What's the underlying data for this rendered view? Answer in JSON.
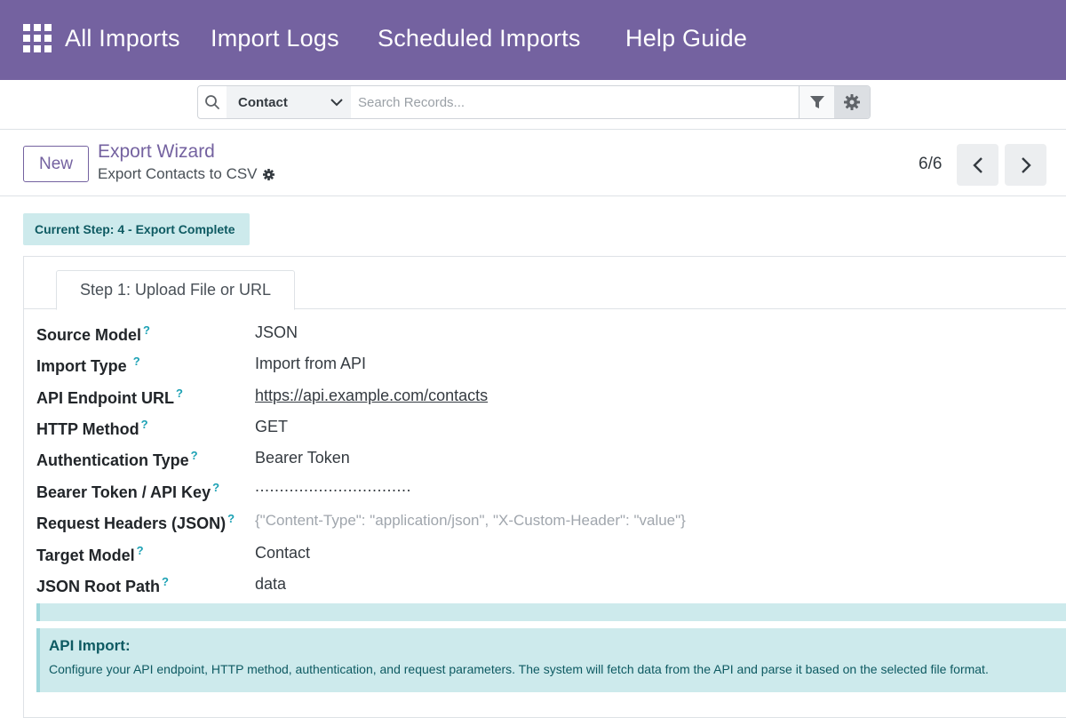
{
  "nav": {
    "items": [
      "All Imports",
      "Import Logs",
      "Scheduled Imports",
      "Help Guide"
    ]
  },
  "search": {
    "model": "Contact",
    "placeholder": "Search Records..."
  },
  "control": {
    "new_label": "New",
    "breadcrumb": "Export Wizard",
    "record_title": "Export Contacts to CSV",
    "pager": "6/6"
  },
  "status": {
    "text": "Current Step: 4 - Export Complete"
  },
  "tab": {
    "label": "Step 1: Upload File or URL"
  },
  "fields": [
    {
      "label": "Source Model",
      "value": "JSON"
    },
    {
      "label": "Import Type",
      "value": "Import from API"
    },
    {
      "label": "API Endpoint URL",
      "value": "https://api.example.com/contacts"
    },
    {
      "label": "HTTP Method",
      "value": "GET"
    },
    {
      "label": "Authentication Type",
      "value": "Bearer Token"
    },
    {
      "label": "Bearer Token / API Key",
      "value": "................................"
    },
    {
      "label": "Request Headers (JSON)",
      "value": "{\"Content-Type\": \"application/json\", \"X-Custom-Header\": \"value\"}"
    },
    {
      "label": "Target Model",
      "value": "Contact"
    },
    {
      "label": "JSON Root Path",
      "value": "data"
    }
  ],
  "help_mark": "?",
  "alert": {
    "title": "API Import:",
    "text": "Configure your API endpoint, HTTP method, authentication, and request parameters. The system will fetch data from the API and parse it based on the selected file format."
  },
  "colors": {
    "brand": "#7462a0",
    "info_bg": "#cdeaec",
    "info_text": "#0e5a62",
    "help_mark": "#1ba1b4"
  }
}
